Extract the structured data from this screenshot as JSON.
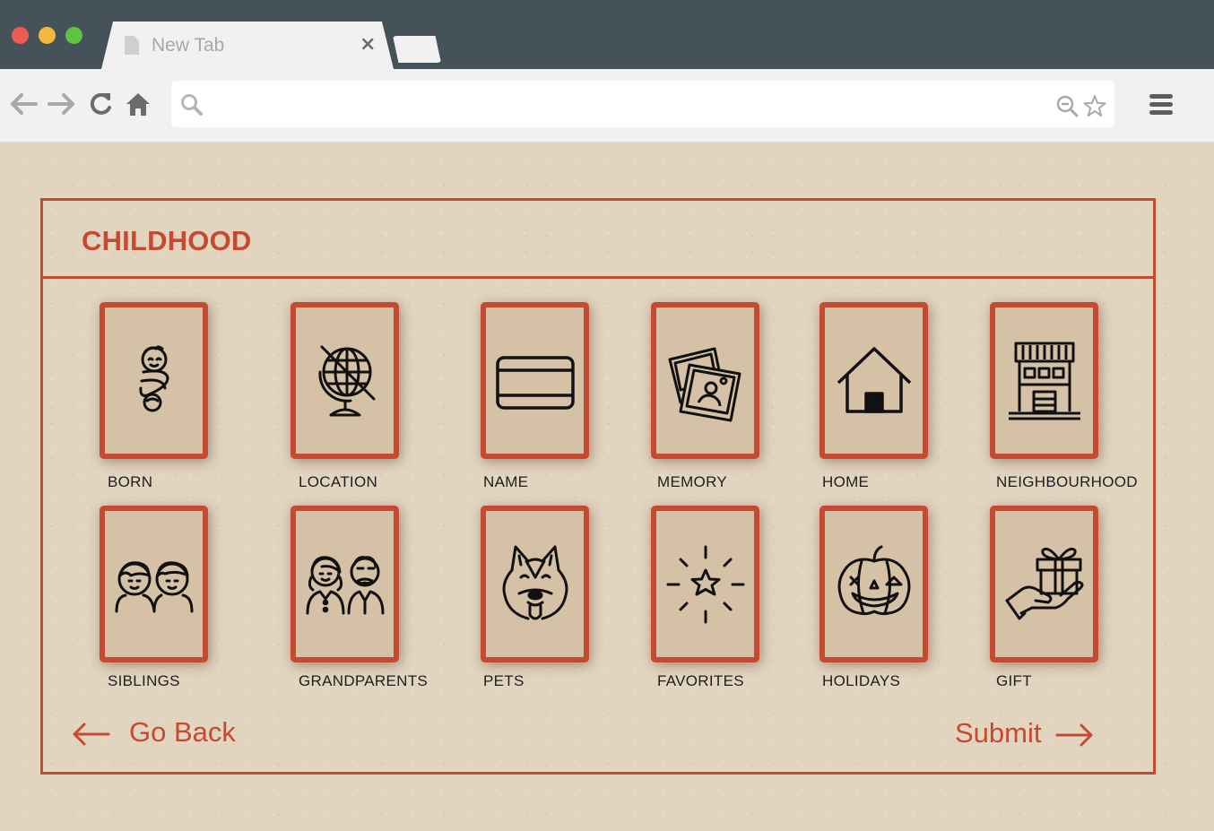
{
  "browser": {
    "tab_title": "New Tab",
    "tab_close": "×",
    "icons": [
      "back-arrow-icon",
      "forward-arrow-icon",
      "reload-icon",
      "home-icon",
      "search-icon",
      "zoom-icon",
      "star-icon",
      "menu-icon"
    ]
  },
  "section": {
    "title": "CHILDHOOD"
  },
  "categories": [
    {
      "label": "BORN",
      "icon": "baby-icon"
    },
    {
      "label": "LOCATION",
      "icon": "globe-icon"
    },
    {
      "label": "NAME",
      "icon": "name-card-icon"
    },
    {
      "label": "MEMORY",
      "icon": "photos-icon"
    },
    {
      "label": "HOME",
      "icon": "house-icon"
    },
    {
      "label": "NEIGHBOURHOOD",
      "icon": "shop-icon"
    },
    {
      "label": "SIBLINGS",
      "icon": "siblings-icon"
    },
    {
      "label": "GRANDPARENTS",
      "icon": "grandparents-icon"
    },
    {
      "label": "PETS",
      "icon": "dog-icon"
    },
    {
      "label": "FAVORITES",
      "icon": "star-burst-icon"
    },
    {
      "label": "HOLIDAYS",
      "icon": "pumpkin-icon"
    },
    {
      "label": "GIFT",
      "icon": "gift-icon"
    }
  ],
  "footer": {
    "back_label": "Go Back",
    "submit_label": "Submit"
  },
  "colors": {
    "accent": "#c64a32",
    "background": "#e2d5c0",
    "card": "#d5c2a6",
    "chrome": "#465259"
  }
}
